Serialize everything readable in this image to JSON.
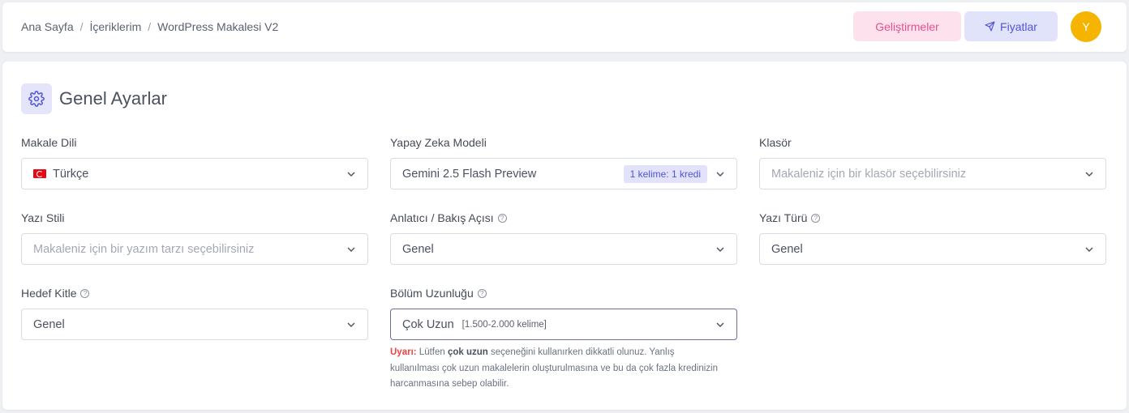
{
  "breadcrumb": {
    "items": [
      "Ana Sayfa",
      "İçeriklerim",
      "WordPress Makalesi V2"
    ],
    "separator": "/"
  },
  "header": {
    "dev_button": "Geliştirmeler",
    "price_button": "Fiyatlar",
    "avatar_initial": "Y"
  },
  "section": {
    "title": "Genel Ayarlar",
    "icon": "gear-icon"
  },
  "fields": {
    "language": {
      "label": "Makale Dili",
      "value": "Türkçe",
      "flag": "tr-flag-icon"
    },
    "model": {
      "label": "Yapay Zeka Modeli",
      "value": "Gemini 2.5 Flash Preview",
      "badge": "1 kelime: 1 kredi"
    },
    "folder": {
      "label": "Klasör",
      "placeholder": "Makaleniz için bir klasör seçebilirsiniz"
    },
    "style": {
      "label": "Yazı Stili",
      "placeholder": "Makaleniz için bir yazım tarzı seçebilirsiniz"
    },
    "narrator": {
      "label": "Anlatıcı / Bakış Açısı",
      "value": "Genel"
    },
    "type": {
      "label": "Yazı Türü",
      "value": "Genel"
    },
    "audience": {
      "label": "Hedef Kitle",
      "value": "Genel"
    },
    "length": {
      "label": "Bölüm Uzunluğu",
      "value": "Çok Uzun",
      "hint": "[1.500-2.000 kelime]"
    }
  },
  "warning": {
    "label": "Uyarı:",
    "text1": " Lütfen ",
    "emphasis": "çok uzun",
    "text2": " seçeneğini kullanırken dikkatli olunuz. Yanlış kullanılması çok uzun makalelerin oluşturulmasına ve bu da çok fazla kredinizin harcanmasına sebep olabilir."
  },
  "colors": {
    "accent": "#4f55d6",
    "pink": "#e84f8e",
    "avatar": "#f5b400",
    "warning": "#ef4444"
  }
}
